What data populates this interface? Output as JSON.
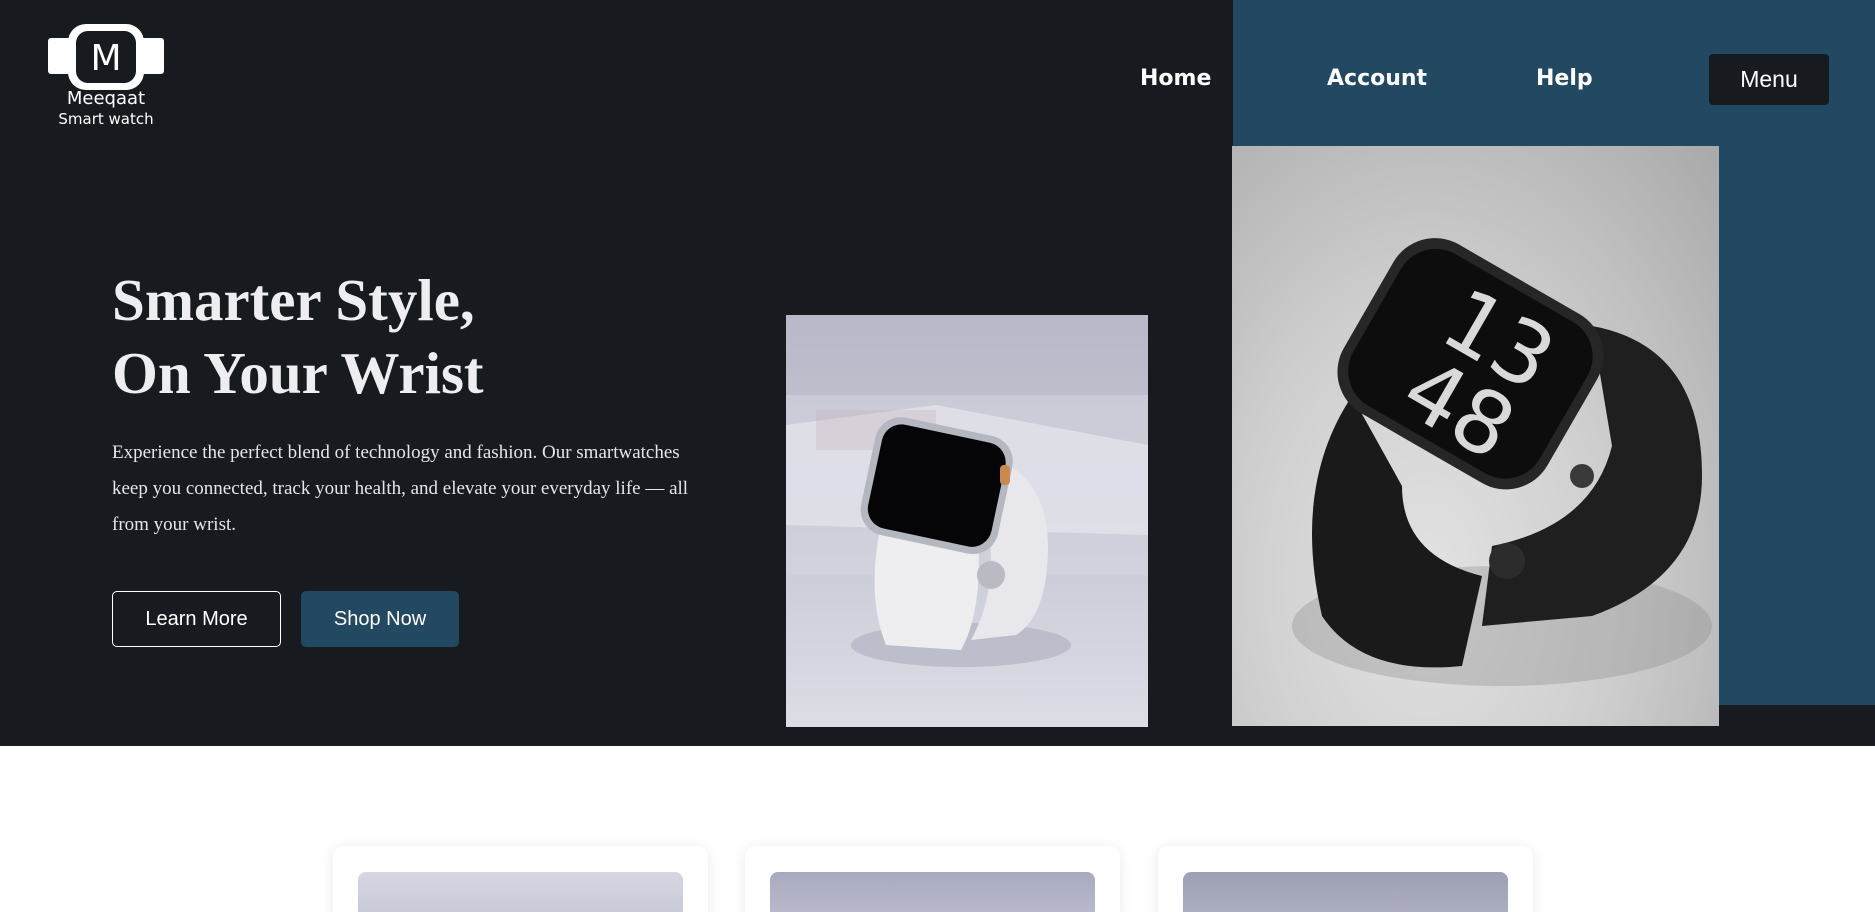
{
  "brand": {
    "logo_letter": "M",
    "name": "Meeqaat",
    "tagline": "Smart watch"
  },
  "nav": {
    "items": [
      {
        "label": "Home"
      },
      {
        "label": "Account"
      },
      {
        "label": "Help"
      }
    ],
    "menu_label": "Menu"
  },
  "hero": {
    "headline_line1": "Smarter Style,",
    "headline_line2": "On Your Wrist",
    "description": "Experience the perfect blend of technology and fashion. Our smartwatches keep you connected, track your health, and elevate your everyday life — all from your wrist.",
    "learn_more_label": "Learn More",
    "shop_now_label": "Shop Now",
    "watch_time_hours": "13",
    "watch_time_minutes": "48"
  },
  "colors": {
    "dark_background": "#171a1f",
    "accent_blue": "#234862",
    "text_light": "#eeeef2"
  },
  "icons": [
    "watch-logo-icon"
  ]
}
